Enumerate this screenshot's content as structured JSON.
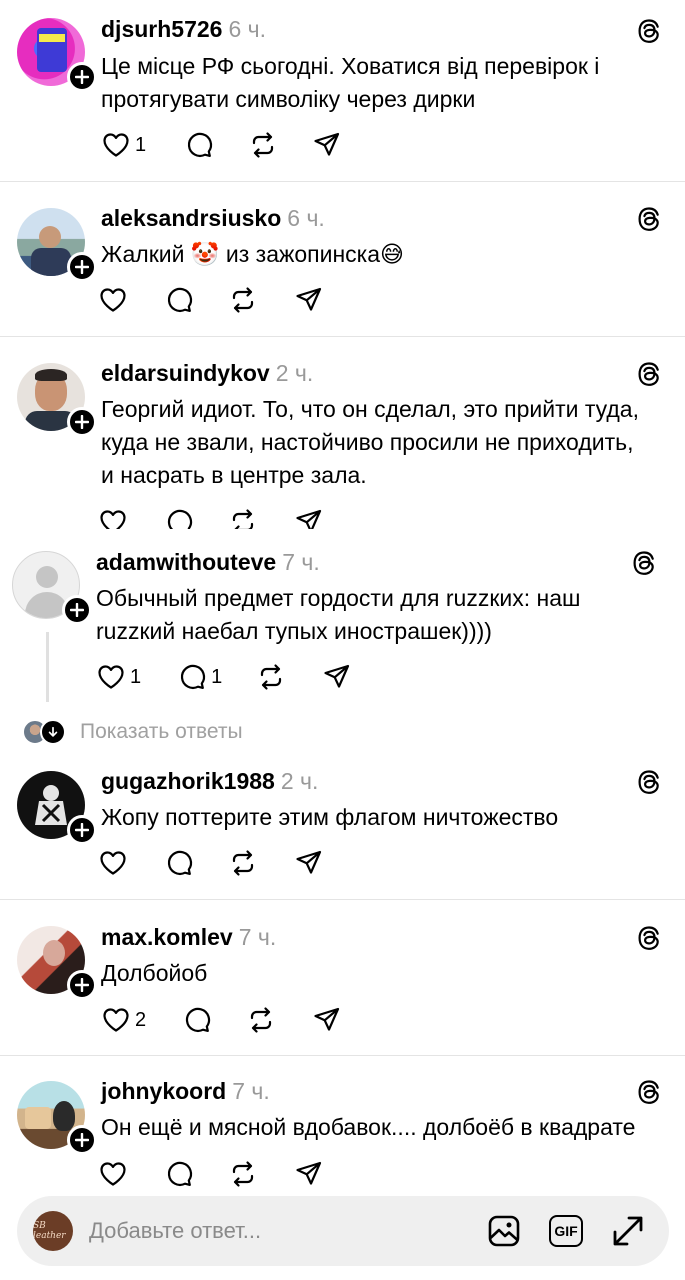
{
  "posts": [
    {
      "username": "djsurh5726",
      "time": "6 ч.",
      "text": "Це місце РФ сьогодні. Ховатися від перевірок і протягувати символіку через дирки",
      "likes": "1",
      "replies": ""
    },
    {
      "username": "aleksandrsiusko",
      "time": "6 ч.",
      "text": "Жалкий 🤡 из зажопинска😅",
      "likes": "",
      "replies": ""
    },
    {
      "username": "eldarsuindykov",
      "time": "2 ч.",
      "text": "Георгий идиот. То, что он сделал, это прийти туда, куда не звали, настойчиво просили не приходить, и насрать в центре зала.",
      "likes": "",
      "replies": ""
    },
    {
      "username": "adamwithouteve",
      "time": "7 ч.",
      "text": "Обычный предмет гордости для ruzzких: наш ruzzкий наебал тупых инострашек))))",
      "likes": "1",
      "replies": "1"
    },
    {
      "username": "gugazhorik1988",
      "time": "2 ч.",
      "text": "Жопу поттерите этим флагом ничтожество",
      "likes": "",
      "replies": ""
    },
    {
      "username": "max.komlev",
      "time": "7 ч.",
      "text": "Долбойоб",
      "likes": "2",
      "replies": ""
    },
    {
      "username": "johnykoord",
      "time": "7 ч.",
      "text": "Он ещё и мясной вдобавок.... долбоёб в квадрате",
      "likes": "",
      "replies": ""
    }
  ],
  "show_replies": {
    "label": "Показать ответы"
  },
  "reply_bar": {
    "placeholder": "Добавьте ответ...",
    "avatar_text": "SB leather",
    "gif_label": "GIF"
  },
  "icons": {
    "like": "heart-icon",
    "reply": "comment-icon",
    "repost": "repost-icon",
    "share": "send-icon",
    "threads": "threads-icon",
    "follow": "plus-icon",
    "image": "image-icon",
    "expand": "expand-icon"
  },
  "colors": {
    "text": "#000000",
    "muted": "#999999",
    "divider": "#e4e4e4",
    "input_bg": "#efefef"
  }
}
